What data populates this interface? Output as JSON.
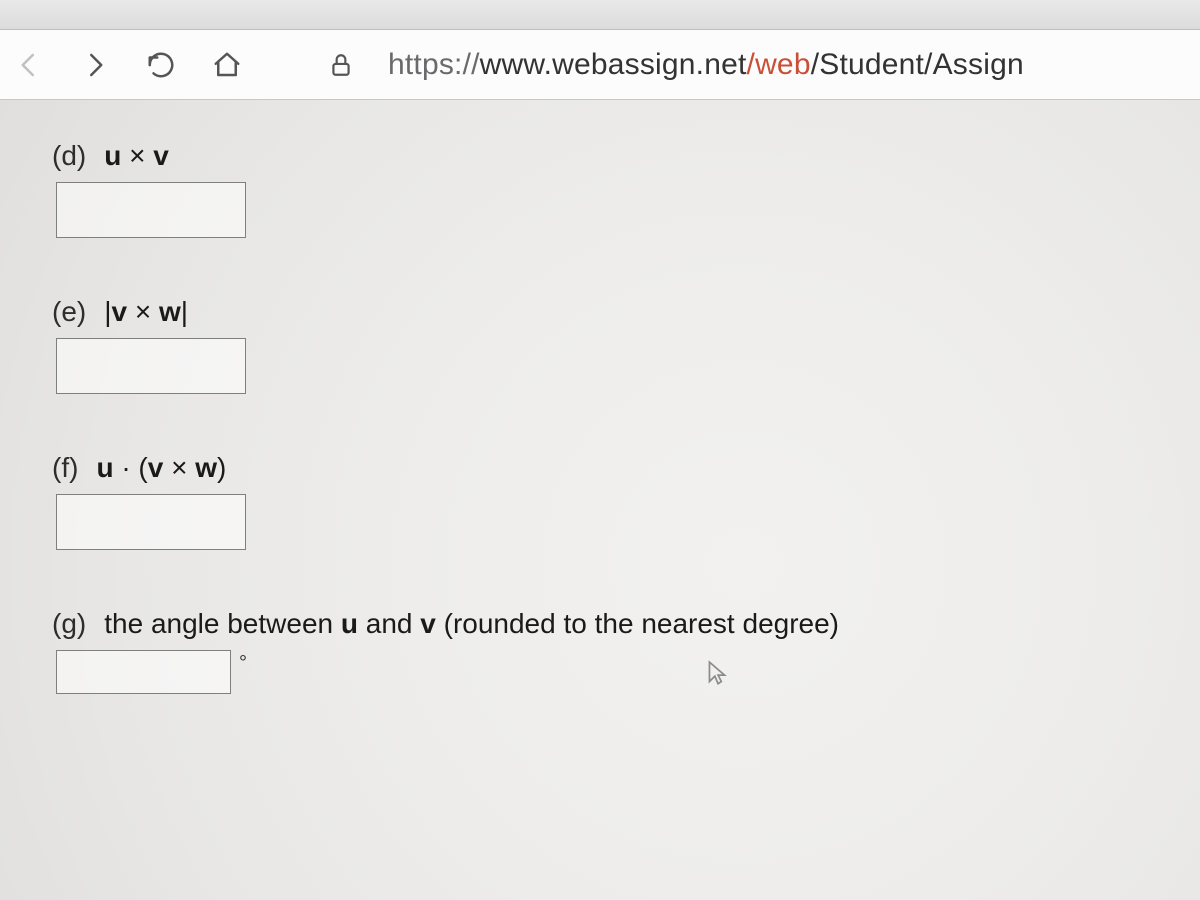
{
  "toolbar": {
    "url_proto": "https://",
    "url_host": "www.webassign.net",
    "url_path_accent": "/web",
    "url_path_rest": "/Student/Assign"
  },
  "problems": {
    "d": {
      "letter": "(d)",
      "expr_html": "<b>u</b> × <b>v</b>"
    },
    "e": {
      "letter": "(e)",
      "expr_html": "|<b>v</b> × <b>w</b>|"
    },
    "f": {
      "letter": "(f)",
      "expr_html": "<b>u</b> · (<b>v</b> × <b>w</b>)"
    },
    "g": {
      "letter": "(g)",
      "expr_html": "the angle between <b>u</b> and <b>v</b> (rounded to the nearest degree)"
    }
  },
  "degree_symbol": "°"
}
